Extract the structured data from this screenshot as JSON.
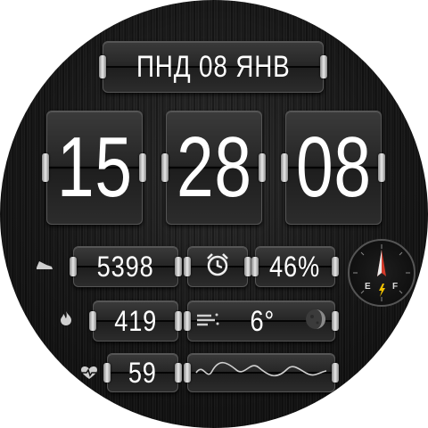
{
  "date": {
    "text": "ПНД 08 ЯНВ"
  },
  "time": {
    "hours": "15",
    "minutes": "28",
    "seconds": "08"
  },
  "steps": {
    "value": "5398",
    "icon": "shoe-icon"
  },
  "alarm": {
    "icon": "alarm-clock-icon"
  },
  "battery": {
    "value": "46%"
  },
  "calories": {
    "value": "419",
    "icon": "flame-icon"
  },
  "weather": {
    "temperature": "6°",
    "wind_icon": "wind-icon",
    "moon_icon": "moon-phase-icon"
  },
  "heart_rate": {
    "value": "59",
    "icon": "heart-pulse-icon"
  },
  "compass": {
    "east_label": "E",
    "north_label": "F"
  },
  "colors": {
    "accent_red": "#d23a2a",
    "bolt_yellow": "#f2c200",
    "digit_white": "#ffffff"
  }
}
